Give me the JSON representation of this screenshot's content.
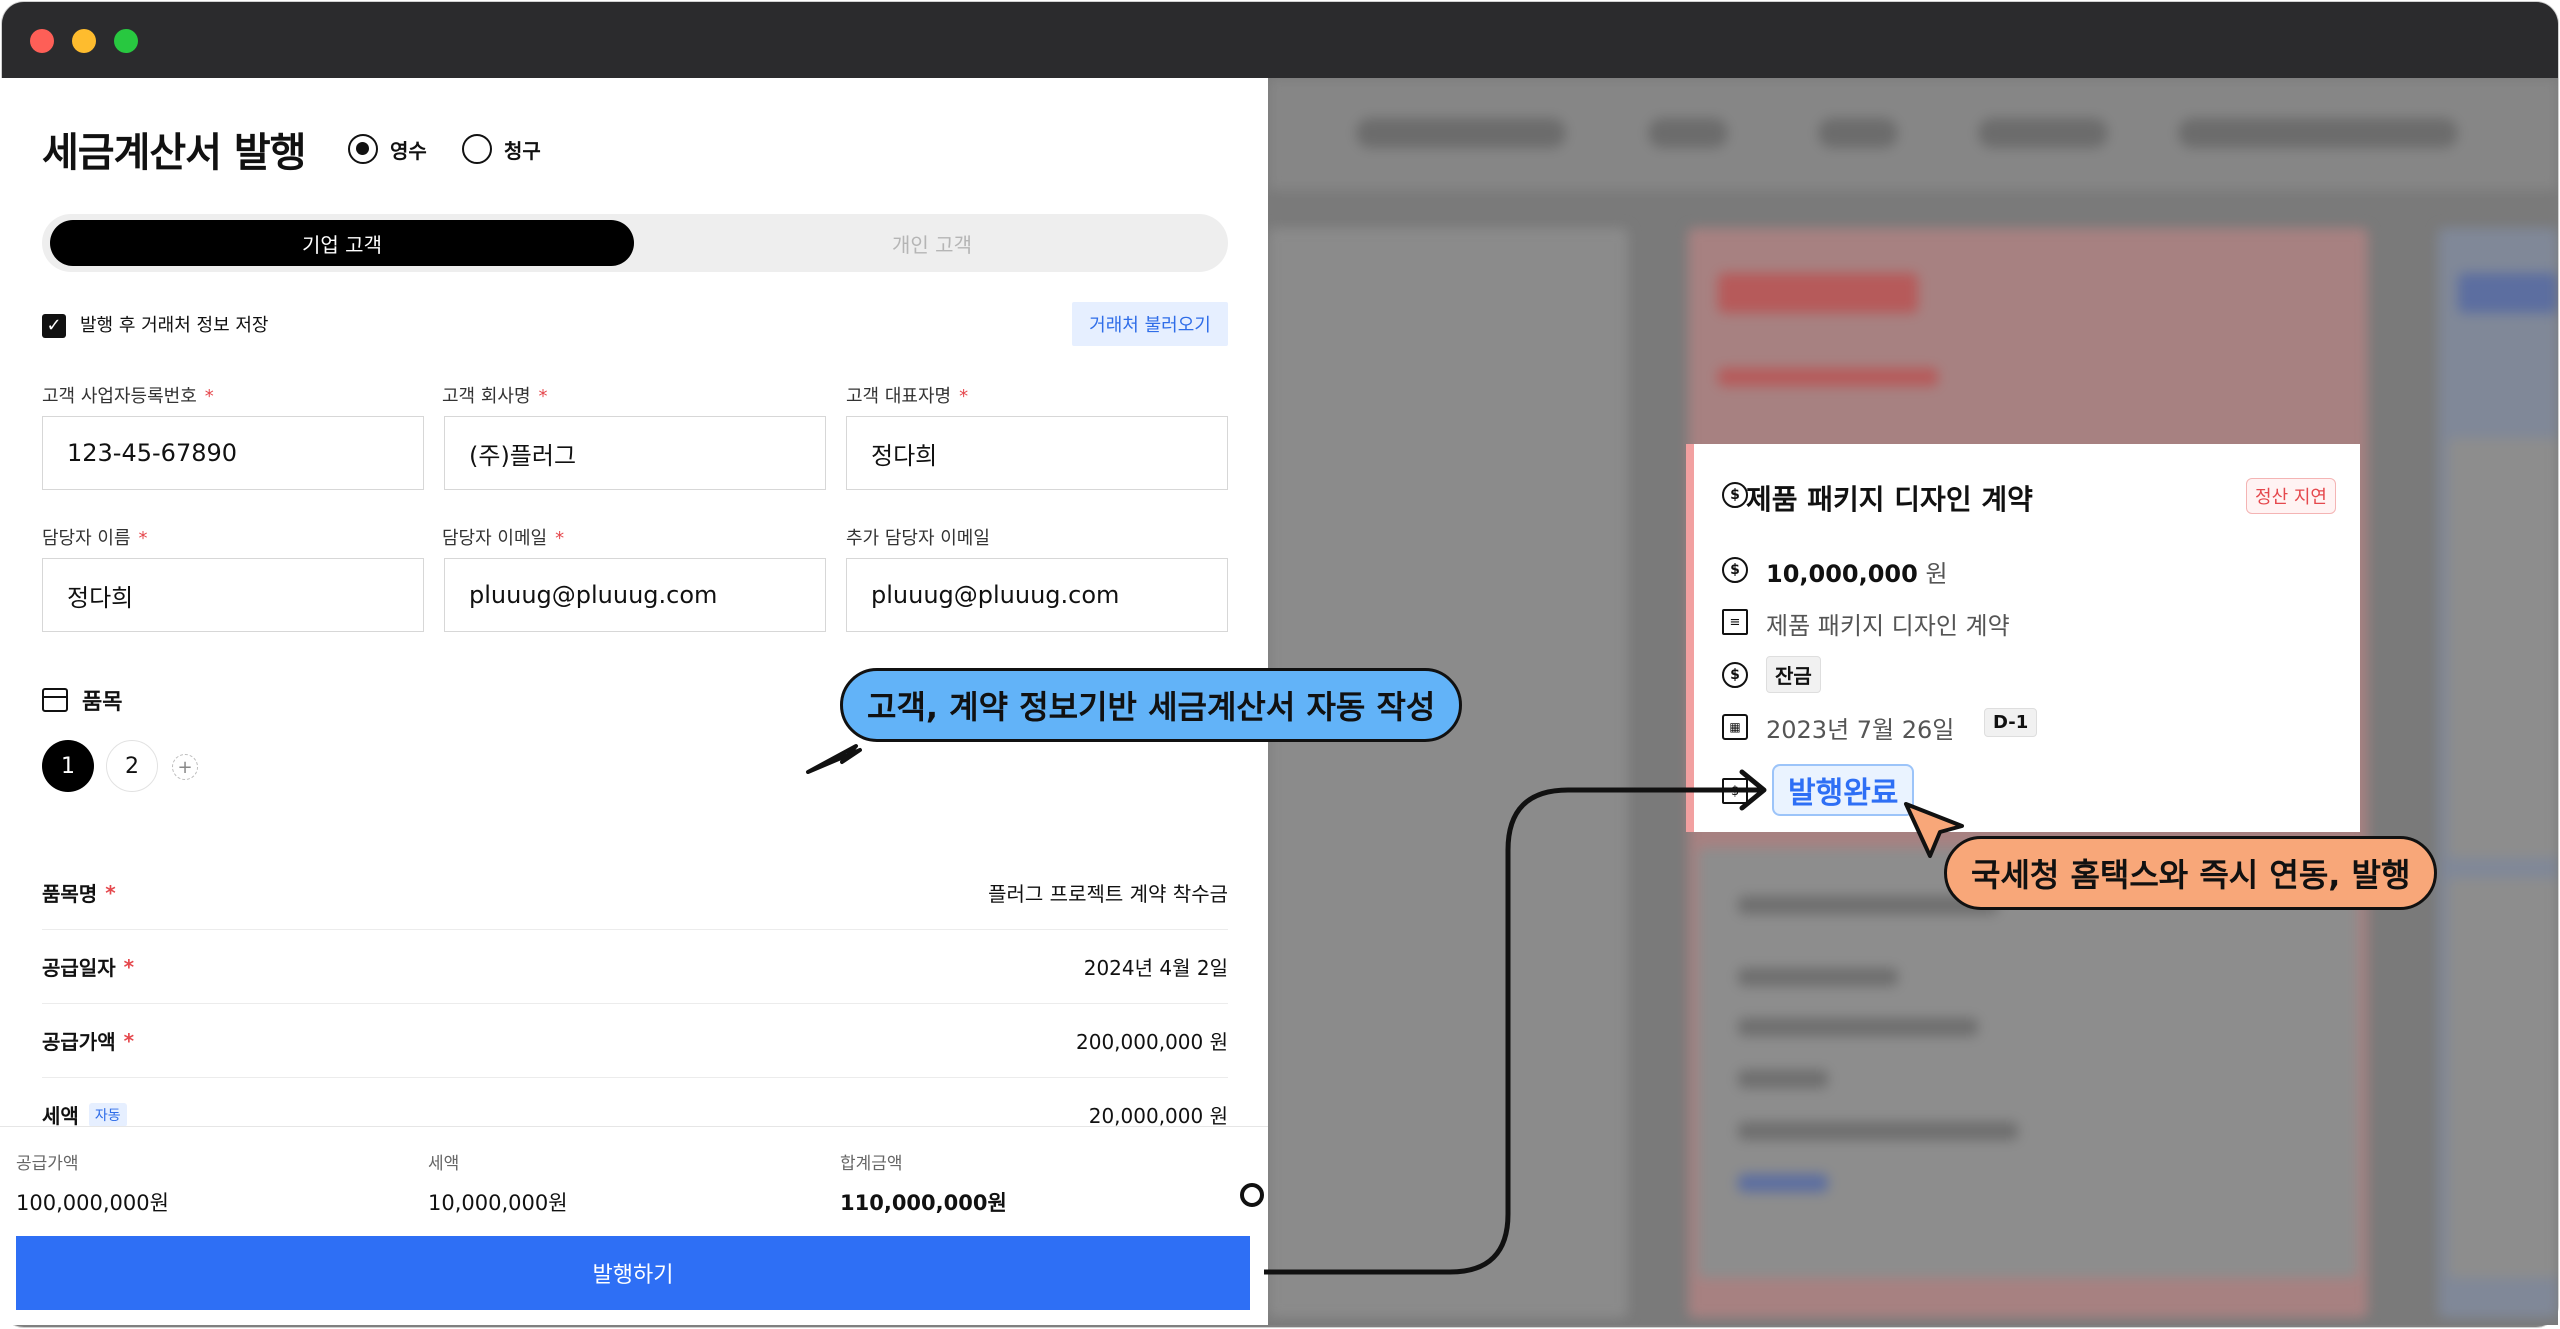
{
  "form": {
    "title": "세금계산서 발행",
    "radio_receipt": "영수",
    "radio_claim": "청구",
    "tab_business": "기업 고객",
    "tab_personal": "개인 고객",
    "save_label": "발행 후 거래처 정보 저장",
    "fetch_button": "거래처 불러오기",
    "required_mark": "*",
    "fields": {
      "biz_no_label": "고객 사업자등록번호",
      "biz_no_value": "123-45-67890",
      "company_label": "고객 회사명",
      "company_value": "(주)플러그",
      "ceo_label": "고객 대표자명",
      "ceo_value": "정다희",
      "manager_label": "담당자 이름",
      "manager_value": "정다희",
      "email_label": "담당자 이메일",
      "email_value": "pluuug@pluuug.com",
      "extra_email_label": "추가 담당자 이메일",
      "extra_email_value": "pluuug@pluuug.com"
    },
    "items_title": "품목",
    "steps": [
      "1",
      "2"
    ],
    "add_step": "+",
    "rows": {
      "item_name_label": "품목명",
      "item_name_value": "플러그 프로젝트 계약 착수금",
      "supply_date_label": "공급일자",
      "supply_date_value": "2024년 4월 2일",
      "supply_amount_label": "공급가액",
      "supply_amount_value": "200,000,000 원",
      "tax_label": "세액",
      "tax_auto_badge": "자동",
      "tax_value": "20,000,000 원"
    },
    "summary": {
      "supply_label": "공급가액",
      "supply_value": "100,000,000원",
      "tax_label": "세액",
      "tax_value": "10,000,000원",
      "total_label": "합계금액",
      "total_value": "110,000,000원"
    },
    "issue_button": "발행하기"
  },
  "card": {
    "title": "제품 패키지 디자인 계약",
    "status_badge": "정산 지연",
    "amount": "10,000,000",
    "amount_unit": "원",
    "contract": "제품 패키지 디자인 계약",
    "payment_type": "잔금",
    "date": "2023년 7월 26일",
    "dday": "D-1",
    "issued_label": "발행완료"
  },
  "callouts": {
    "auto_write": "고객, 계약 정보기반 세금계산서 자동 작성",
    "hometax": "국세청 홈택스와 즉시 연동, 발행"
  },
  "colors": {
    "primary": "#2e6ff5",
    "required": "#e5484d",
    "callout_blue": "#62b3f8",
    "callout_orange": "#f8a779",
    "delay_border": "#f2a0a0"
  }
}
